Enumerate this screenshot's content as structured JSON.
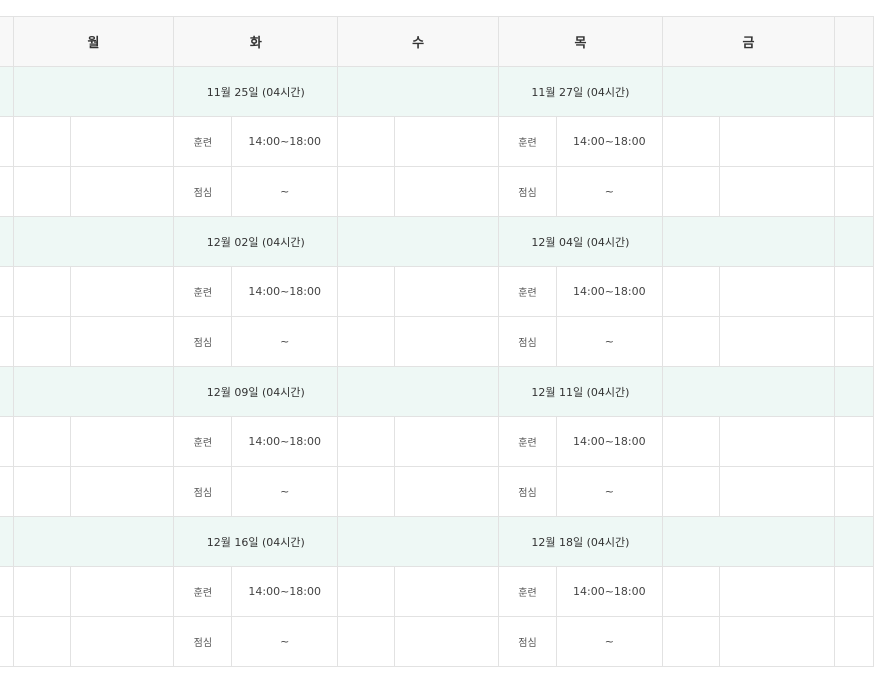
{
  "header": {
    "days": [
      "월",
      "화",
      "수",
      "목",
      "금"
    ]
  },
  "labels": {
    "training": "훈련",
    "lunch": "점심",
    "time": "14:00~18:00",
    "lunch_time": "~"
  },
  "weeks": [
    {
      "tue": "11월 25일 (04시간)",
      "thu": "11월 27일 (04시간)"
    },
    {
      "tue": "12월 02일 (04시간)",
      "thu": "12월 04일 (04시간)"
    },
    {
      "tue": "12월 09일 (04시간)",
      "thu": "12월 11일 (04시간)"
    },
    {
      "tue": "12월 16일 (04시간)",
      "thu": "12월 18일 (04시간)"
    }
  ]
}
